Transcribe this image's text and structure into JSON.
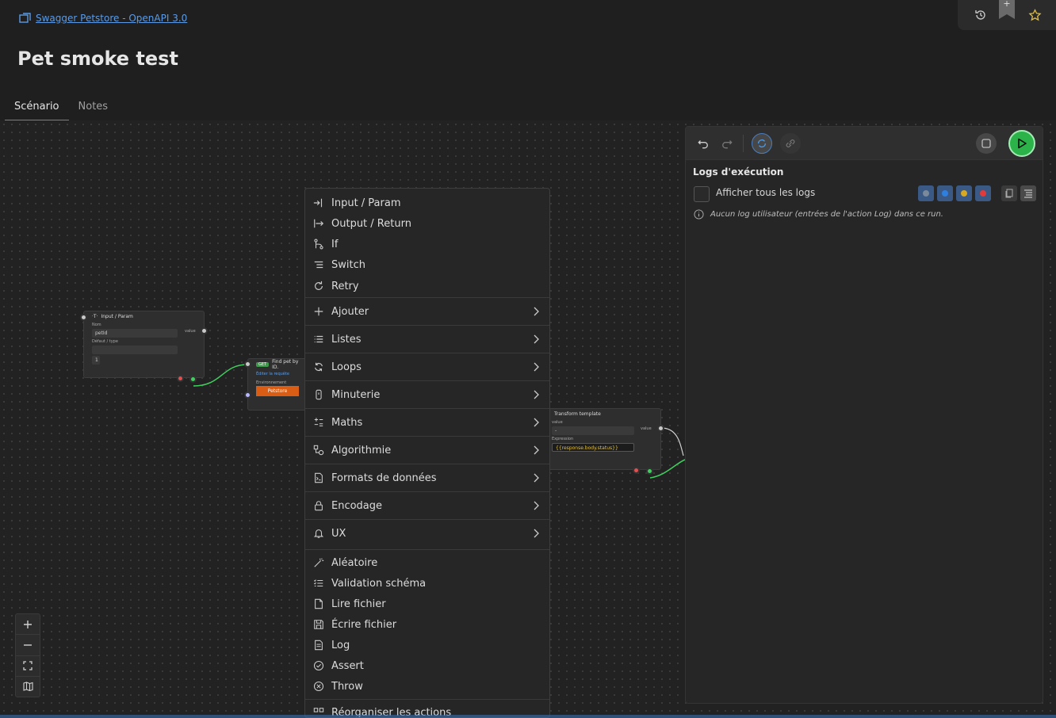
{
  "breadcrumb": {
    "label": "Swagger Petstore - OpenAPI 3.0"
  },
  "page": {
    "title": "Pet smoke test"
  },
  "tabs": [
    {
      "label": "Scénario",
      "active": true
    },
    {
      "label": "Notes",
      "active": false
    }
  ],
  "top_actions": {
    "icons": [
      "history-icon",
      "bookmark-add-icon",
      "star-icon"
    ],
    "bookmark_plus": "+"
  },
  "nodes": {
    "input_param": {
      "title": "Input / Param",
      "name_label": "Nom",
      "name_value": "petId",
      "default_type_label": "Défaut / type",
      "output_label": "value",
      "index_value": "1"
    },
    "find_pet": {
      "method": "GET",
      "title": "Find pet by ID.",
      "link": "Éditer la requête",
      "env_label": "Environnement",
      "env_value": "Petstore"
    },
    "transform": {
      "title": "Transform template",
      "value_label": "value",
      "value_text": "-",
      "expression_label": "Expression",
      "expression_text": "{{response.body.status}}",
      "output_label": "value"
    }
  },
  "menu": {
    "top_items": [
      {
        "label": "Input / Param",
        "icon": "input-icon"
      },
      {
        "label": "Output / Return",
        "icon": "output-icon"
      },
      {
        "label": "If",
        "icon": "branch-icon"
      },
      {
        "label": "Switch",
        "icon": "switch-icon"
      },
      {
        "label": "Retry",
        "icon": "retry-icon"
      }
    ],
    "sub_items": [
      {
        "label": "Ajouter",
        "icon": "plus-icon"
      },
      {
        "label": "Listes",
        "icon": "list-icon"
      },
      {
        "label": "Loops",
        "icon": "loop-icon"
      },
      {
        "label": "Minuterie",
        "icon": "timer-icon"
      },
      {
        "label": "Maths",
        "icon": "math-icon"
      },
      {
        "label": "Algorithmie",
        "icon": "algorithm-icon"
      },
      {
        "label": "Formats de données",
        "icon": "file-format-icon"
      },
      {
        "label": "Encodage",
        "icon": "lock-icon"
      },
      {
        "label": "UX",
        "icon": "bell-icon"
      }
    ],
    "bottom_items": [
      {
        "label": "Aléatoire",
        "icon": "magic-wand-icon"
      },
      {
        "label": "Validation schéma",
        "icon": "checklist-icon"
      },
      {
        "label": "Lire fichier",
        "icon": "file-icon"
      },
      {
        "label": "Écrire fichier",
        "icon": "save-icon"
      },
      {
        "label": "Log",
        "icon": "log-icon"
      },
      {
        "label": "Assert",
        "icon": "check-circle-icon"
      },
      {
        "label": "Throw",
        "icon": "x-circle-icon"
      },
      {
        "label": "Réorganiser les actions",
        "icon": "reorder-icon"
      }
    ]
  },
  "log_panel": {
    "title": "Logs d'exécution",
    "show_all_label": "Afficher tous les logs",
    "info_text": "Aucun log utilisateur (entrées de l'action Log) dans ce run.",
    "levels": [
      {
        "name": "debug",
        "color": "#7a8a9a"
      },
      {
        "name": "info",
        "color": "#2f7fe0"
      },
      {
        "name": "warn",
        "color": "#d8a820"
      },
      {
        "name": "error",
        "color": "#e03a3a"
      }
    ]
  },
  "colors": {
    "accent": "#3f8bdc",
    "run": "#2bb34a",
    "link": "#5b9be6",
    "env_button": "#d95d14"
  }
}
